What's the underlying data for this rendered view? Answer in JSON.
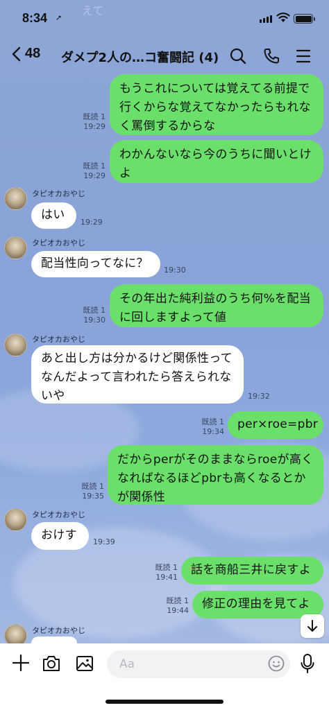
{
  "status_bar": {
    "time": "8:34",
    "ghost_text": "えて"
  },
  "header": {
    "back_count": "48",
    "title": "ダメプ2人の…コ奮闘記 (4)"
  },
  "messages": [
    {
      "dir": "out",
      "lines": [
        "もうこれについては覚えてる前提で",
        "行くからな覚えてなかったらもれな",
        "く罵倒するからな"
      ],
      "read": "既読 1",
      "time": "19:29"
    },
    {
      "dir": "out",
      "lines": [
        "わかんないなら今のうちに聞いとけ",
        "よ"
      ],
      "read": "既読 1",
      "time": "19:29"
    },
    {
      "dir": "in",
      "sender": "タピオカおやじ",
      "lines": [
        "はい"
      ],
      "time": "19:29"
    },
    {
      "dir": "in",
      "sender": "タピオカおやじ",
      "lines": [
        "配当性向ってなに？"
      ],
      "time": "19:30"
    },
    {
      "dir": "out",
      "lines": [
        "その年出た純利益のうち何%を配当",
        "に回しますよって値"
      ],
      "read": "既読 1",
      "time": "19:30"
    },
    {
      "dir": "in",
      "sender": "タピオカおやじ",
      "lines": [
        "あと出し方は分かるけど関係性って",
        "なんだよって言われたら答えられな",
        "いや"
      ],
      "time": "19:32"
    },
    {
      "dir": "out",
      "lines": [
        "per×roe=pbr"
      ],
      "read": "既読 1",
      "time": "19:34"
    },
    {
      "dir": "out",
      "lines": [
        "だからperがそのままならroeが高く",
        "なればなるほどpbrも高くなるとか",
        "が関係性"
      ],
      "read": "既読 1",
      "time": "19:35"
    },
    {
      "dir": "in",
      "sender": "タピオカおやじ",
      "lines": [
        "おけす"
      ],
      "time": "19:39"
    },
    {
      "dir": "out",
      "lines": [
        "話を商船三井に戻すよ"
      ],
      "read": "既読 1",
      "time": "19:41"
    },
    {
      "dir": "out",
      "lines": [
        "修正の理由を見てよ"
      ],
      "read": "既読 1",
      "time": "19:44"
    },
    {
      "dir": "in",
      "sender": "タピオカおやじ",
      "lines": [],
      "time": ""
    }
  ],
  "input": {
    "placeholder": "Aa"
  },
  "icons": {
    "back": "chevron-left-icon",
    "search": "search-icon",
    "call": "phone-icon",
    "menu": "menu-icon",
    "plus": "plus-icon",
    "camera": "camera-icon",
    "image": "image-icon",
    "emoji": "emoji-icon",
    "mic": "microphone-icon",
    "scroll": "arrow-down-icon"
  },
  "colors": {
    "outgoing": "#6ae06a",
    "incoming": "#ffffff",
    "background": "#8ea6d6"
  }
}
